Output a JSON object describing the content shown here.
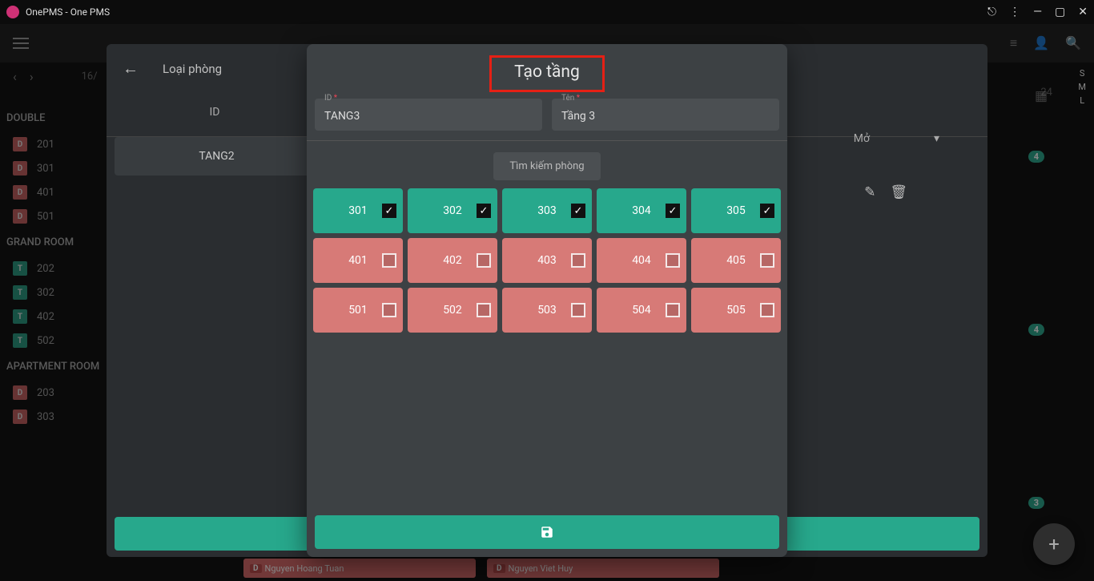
{
  "titlebar": {
    "title": "OnePMS - One PMS"
  },
  "backPanel": {
    "title": "Loại phòng",
    "columnId": "ID",
    "row": "TANG2",
    "dropdown": "Mở"
  },
  "background": {
    "date": "16/",
    "rightDate": "24",
    "rightLetters": [
      "S",
      "M",
      "L"
    ],
    "groups": [
      {
        "name": "DOUBLE",
        "rooms": [
          {
            "badge": "D",
            "badgeClass": "badge-d",
            "num": "201"
          },
          {
            "badge": "D",
            "badgeClass": "badge-d",
            "num": "301"
          },
          {
            "badge": "D",
            "badgeClass": "badge-d",
            "num": "401"
          },
          {
            "badge": "D",
            "badgeClass": "badge-d",
            "num": "501"
          }
        ]
      },
      {
        "name": "GRAND ROOM",
        "rooms": [
          {
            "badge": "T",
            "badgeClass": "badge-t",
            "num": "202"
          },
          {
            "badge": "T",
            "badgeClass": "badge-t",
            "num": "302"
          },
          {
            "badge": "T",
            "badgeClass": "badge-t",
            "num": "402"
          },
          {
            "badge": "T",
            "badgeClass": "badge-t",
            "num": "502"
          }
        ]
      },
      {
        "name": "APARTMENT ROOM",
        "rooms": [
          {
            "badge": "D",
            "badgeClass": "badge-d",
            "num": "203"
          },
          {
            "badge": "D",
            "badgeClass": "badge-d",
            "num": "303"
          }
        ]
      }
    ],
    "bookings": [
      {
        "label": "Nguyen Hoang Tuan"
      },
      {
        "label": "Nguyen Viet Huy"
      }
    ],
    "counts": [
      "4",
      "4",
      "3"
    ]
  },
  "modal": {
    "title": "Tạo tầng",
    "fields": {
      "id": {
        "label": "ID",
        "value": "TANG3"
      },
      "name": {
        "label": "Tên",
        "value": "Tầng 3"
      }
    },
    "search": "Tìm kiếm phòng",
    "rooms": [
      [
        {
          "num": "301",
          "selected": true
        },
        {
          "num": "302",
          "selected": true
        },
        {
          "num": "303",
          "selected": true
        },
        {
          "num": "304",
          "selected": true
        },
        {
          "num": "305",
          "selected": true
        }
      ],
      [
        {
          "num": "401",
          "selected": false
        },
        {
          "num": "402",
          "selected": false
        },
        {
          "num": "403",
          "selected": false
        },
        {
          "num": "404",
          "selected": false
        },
        {
          "num": "405",
          "selected": false
        }
      ],
      [
        {
          "num": "501",
          "selected": false
        },
        {
          "num": "502",
          "selected": false
        },
        {
          "num": "503",
          "selected": false
        },
        {
          "num": "504",
          "selected": false
        },
        {
          "num": "505",
          "selected": false
        }
      ]
    ]
  }
}
